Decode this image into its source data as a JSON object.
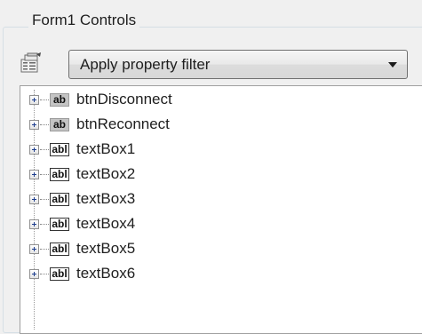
{
  "group": {
    "title": "Form1 Controls"
  },
  "toolbar": {
    "properties_icon": "property-pages-icon",
    "filter_combo_value": "Apply property filter"
  },
  "tree": {
    "items": [
      {
        "label": "btnDisconnect",
        "icon": "button-icon",
        "icon_text": "ab"
      },
      {
        "label": "btnReconnect",
        "icon": "button-icon",
        "icon_text": "ab"
      },
      {
        "label": "textBox1",
        "icon": "textbox-icon",
        "icon_text": "abl"
      },
      {
        "label": "textBox2",
        "icon": "textbox-icon",
        "icon_text": "abl"
      },
      {
        "label": "textBox3",
        "icon": "textbox-icon",
        "icon_text": "abl"
      },
      {
        "label": "textBox4",
        "icon": "textbox-icon",
        "icon_text": "abl"
      },
      {
        "label": "textBox5",
        "icon": "textbox-icon",
        "icon_text": "abl"
      },
      {
        "label": "textBox6",
        "icon": "textbox-icon",
        "icon_text": "abl"
      }
    ]
  }
}
